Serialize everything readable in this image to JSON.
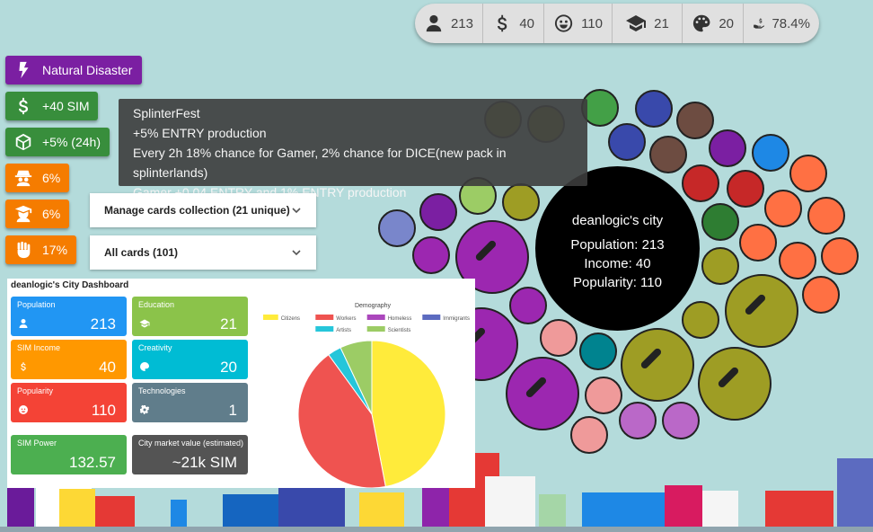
{
  "stats": [
    {
      "icon": "person-icon",
      "value": "213"
    },
    {
      "icon": "dollar-icon",
      "value": "40"
    },
    {
      "icon": "smile-icon",
      "value": "110"
    },
    {
      "icon": "graduation-cap-icon",
      "value": "21"
    },
    {
      "icon": "palette-icon",
      "value": "20"
    },
    {
      "icon": "hand-money-icon",
      "value": "78.4%"
    }
  ],
  "left_buttons": [
    {
      "label": "Natural Disaster",
      "icon": "lightning-icon",
      "color": "#7b1fa2"
    },
    {
      "label": "+40 SIM",
      "icon": "dollar-icon",
      "color": "#388e3c"
    },
    {
      "label": "+5% (24h)",
      "icon": "dice-icon",
      "color": "#388e3c"
    },
    {
      "label": "6%",
      "icon": "spy-icon",
      "color": "#f57c00"
    },
    {
      "label": "6%",
      "icon": "teacher-icon",
      "color": "#f57c00"
    },
    {
      "label": "17%",
      "icon": "fist-icon",
      "color": "#f57c00"
    }
  ],
  "tooltip": {
    "line1": "SplinterFest",
    "line2": "+5% ENTRY production",
    "line3": "Every 2h 18% chance for Gamer, 2% chance for DICE(new pack in splinterlands)",
    "line4": "Gamer +0.04 ENTRY and 1% ENTRY production"
  },
  "dropdowns": {
    "manage": "Manage cards collection (21 unique)",
    "all": "All cards (101)"
  },
  "dashboard": {
    "title": "deanlogic's City Dashboard",
    "tiles": [
      {
        "label": "Population",
        "value": "213",
        "color": "#2196f3",
        "icon": "person-icon"
      },
      {
        "label": "Education",
        "value": "21",
        "color": "#8bc34a",
        "icon": "graduation-cap-icon"
      },
      {
        "label": "SIM Income",
        "value": "40",
        "color": "#ff9800",
        "icon": "dollar-icon"
      },
      {
        "label": "Creativity",
        "value": "20",
        "color": "#00bcd4",
        "icon": "palette-icon"
      },
      {
        "label": "Popularity",
        "value": "110",
        "color": "#f44336",
        "icon": "smile-icon"
      },
      {
        "label": "Technologies",
        "value": "1",
        "color": "#607d8b",
        "icon": "gear-icon"
      },
      {
        "label": "SIM Power",
        "value": "132.57",
        "color": "#4caf50",
        "icon": ""
      },
      {
        "label": "City market value (estimated)",
        "value": "~21k SIM",
        "color": "#545454",
        "icon": ""
      }
    ]
  },
  "chart_data": {
    "type": "pie",
    "title": "Demography",
    "legend_position": "top",
    "categories": [
      "Citizens",
      "Workers",
      "Homeless",
      "Immigrants",
      "Artists",
      "Scientists"
    ],
    "values": [
      47,
      43,
      0,
      0,
      3,
      7
    ],
    "colors": [
      "#ffeb3b",
      "#ef5350",
      "#ab47bc",
      "#5c6bc0",
      "#26c6da",
      "#9ccc65"
    ]
  },
  "city": {
    "name": "deanlogic's city",
    "population_label": "Population: 213",
    "income_label": "Income: 40",
    "popularity_label": "Popularity: 110"
  }
}
